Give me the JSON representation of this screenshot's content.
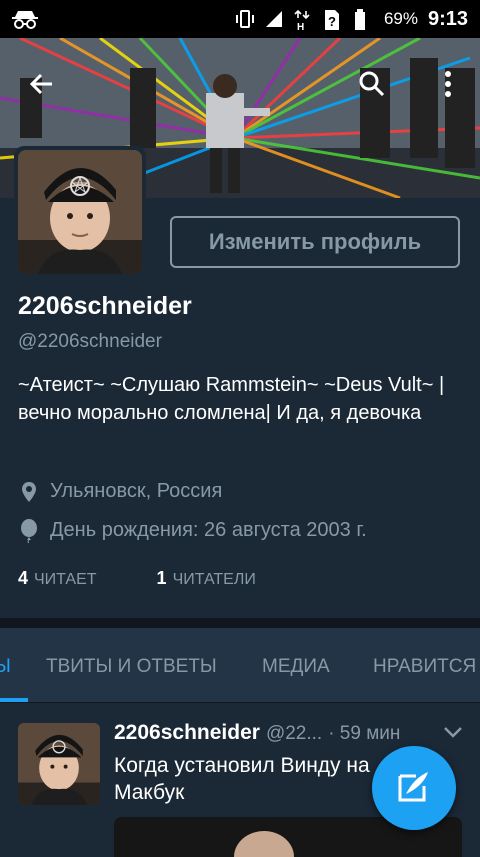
{
  "status_bar": {
    "battery_percent": "69%",
    "time": "9:13",
    "icons": [
      "incognito-icon",
      "vibrate-icon",
      "signal-icon",
      "data-h-icon",
      "sim-unknown-icon",
      "battery-icon"
    ]
  },
  "toolbar": {
    "icons": [
      "back-arrow-icon",
      "search-icon",
      "more-vert-icon"
    ]
  },
  "profile": {
    "edit_button": "Изменить профиль",
    "name": "2206schneider",
    "handle": "@2206schneider",
    "bio": "~Атеист~ ~Слушаю Rammstein~ ~Deus Vult~ |вечно морально сломлена| И да, я девочка",
    "location": "Ульяновск, Россия",
    "birthday": "День рождения: 26 августа 2003 г.",
    "following_count": "4",
    "following_label": "ЧИТАЕТ",
    "followers_count": "1",
    "followers_label": "ЧИТАТЕЛИ"
  },
  "tabs": [
    {
      "label": "ТВИТЫ",
      "visible_label": "Ы",
      "active": true
    },
    {
      "label": "ТВИТЫ И ОТВЕТЫ",
      "active": false
    },
    {
      "label": "МЕДИА",
      "active": false
    },
    {
      "label": "НРАВИТСЯ",
      "active": false
    }
  ],
  "tweet": {
    "name": "2206schneider",
    "handle": "@22...",
    "time": "· 59 мин",
    "text": "Когда установил Винду на Макбук"
  },
  "colors": {
    "background": "#1b2836",
    "accent": "#1da1f2",
    "secondary_text": "#8899a6",
    "tab_bar": "#243447"
  }
}
